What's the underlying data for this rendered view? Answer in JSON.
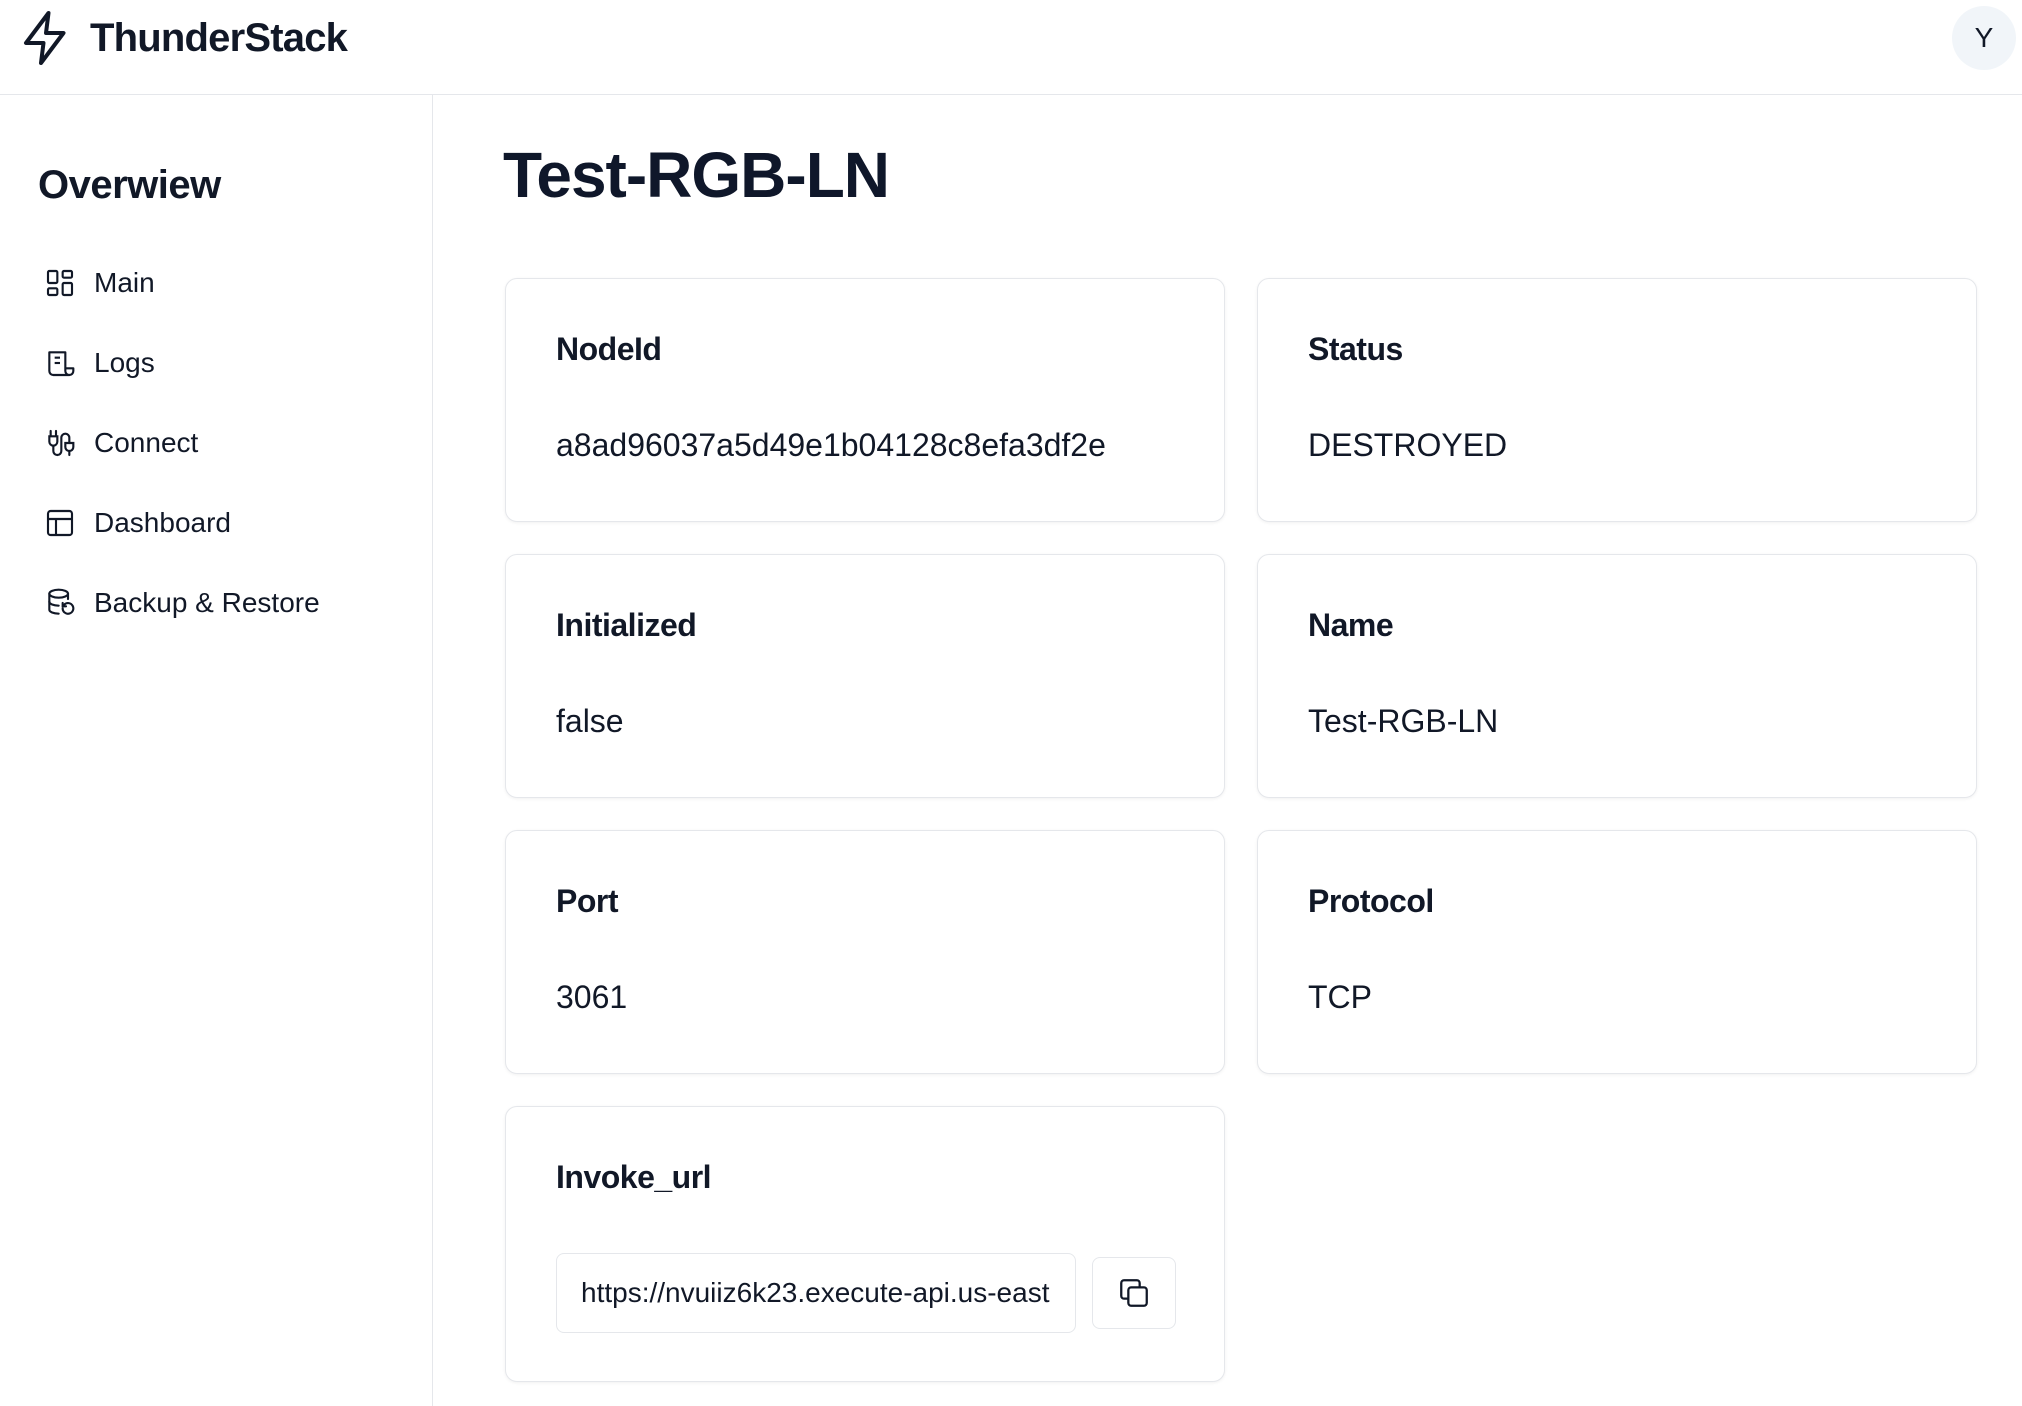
{
  "app": {
    "name": "ThunderStack",
    "avatar_initial": "Y"
  },
  "sidebar": {
    "title": "Overwiew",
    "items": [
      {
        "label": "Main",
        "icon": "dashboard-grid-icon"
      },
      {
        "label": "Logs",
        "icon": "scroll-icon"
      },
      {
        "label": "Connect",
        "icon": "plug-icon"
      },
      {
        "label": "Dashboard",
        "icon": "layout-icon"
      },
      {
        "label": "Backup & Restore",
        "icon": "database-restore-icon"
      }
    ]
  },
  "page": {
    "title": "Test-RGB-LN"
  },
  "details": {
    "node_id": {
      "label": "NodeId",
      "value": "a8ad96037a5d49e1b04128c8efa3df2e"
    },
    "status": {
      "label": "Status",
      "value": "DESTROYED"
    },
    "initialized": {
      "label": "Initialized",
      "value": "false"
    },
    "name": {
      "label": "Name",
      "value": "Test-RGB-LN"
    },
    "port": {
      "label": "Port",
      "value": "3061"
    },
    "protocol": {
      "label": "Protocol",
      "value": "TCP"
    },
    "invoke_url": {
      "label": "Invoke_url",
      "value": "https://nvuiiz6k23.execute-api.us-east"
    }
  }
}
